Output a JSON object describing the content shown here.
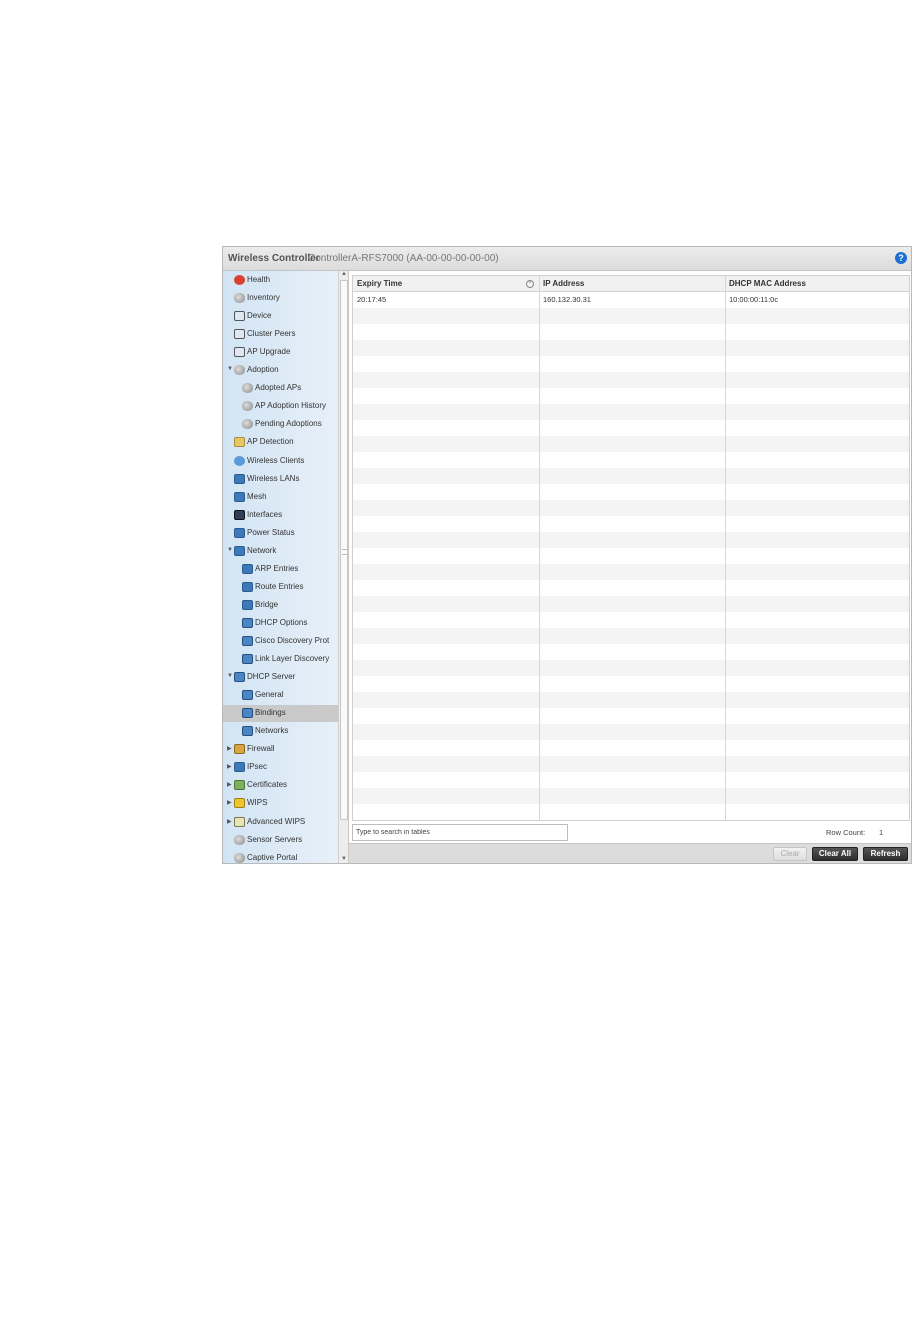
{
  "header": {
    "app_title": "Wireless Controller",
    "controller_id": "ControllerA-RFS7000 (AA-00-00-00-00-00)",
    "help_glyph": "?"
  },
  "sidebar": {
    "items": [
      {
        "label": "Health",
        "icon": "health-icon",
        "level": 0,
        "expander": ""
      },
      {
        "label": "Inventory",
        "icon": "inventory-icon",
        "level": 0,
        "expander": ""
      },
      {
        "label": "Device",
        "icon": "device-icon",
        "level": 0,
        "expander": ""
      },
      {
        "label": "Cluster Peers",
        "icon": "cluster-icon",
        "level": 0,
        "expander": ""
      },
      {
        "label": "AP Upgrade",
        "icon": "ap-upgrade-icon",
        "level": 0,
        "expander": ""
      },
      {
        "label": "Adoption",
        "icon": "adoption-icon",
        "level": 0,
        "expander": "▼"
      },
      {
        "label": "Adopted APs",
        "icon": "ap-icon",
        "level": 1,
        "expander": ""
      },
      {
        "label": "AP Adoption History",
        "icon": "ap-icon",
        "level": 1,
        "expander": ""
      },
      {
        "label": "Pending Adoptions",
        "icon": "ap-icon",
        "level": 1,
        "expander": ""
      },
      {
        "label": "AP Detection",
        "icon": "ap-detection-icon",
        "level": 0,
        "expander": ""
      },
      {
        "label": "Wireless Clients",
        "icon": "clients-icon",
        "level": 0,
        "expander": ""
      },
      {
        "label": "Wireless LANs",
        "icon": "wlan-icon",
        "level": 0,
        "expander": ""
      },
      {
        "label": "Mesh",
        "icon": "mesh-icon",
        "level": 0,
        "expander": ""
      },
      {
        "label": "Interfaces",
        "icon": "interfaces-icon",
        "level": 0,
        "expander": ""
      },
      {
        "label": "Power Status",
        "icon": "power-icon",
        "level": 0,
        "expander": ""
      },
      {
        "label": "Network",
        "icon": "network-icon",
        "level": 0,
        "expander": "▼"
      },
      {
        "label": "ARP Entries",
        "icon": "network-icon",
        "level": 1,
        "expander": ""
      },
      {
        "label": "Route Entries",
        "icon": "network-icon",
        "level": 1,
        "expander": ""
      },
      {
        "label": "Bridge",
        "icon": "bridge-icon",
        "level": 1,
        "expander": ""
      },
      {
        "label": "DHCP Options",
        "icon": "dhcp-icon",
        "level": 1,
        "expander": ""
      },
      {
        "label": "Cisco Discovery Prot",
        "icon": "dhcp-icon",
        "level": 1,
        "expander": ""
      },
      {
        "label": "Link Layer Discovery",
        "icon": "dhcp-icon",
        "level": 1,
        "expander": ""
      },
      {
        "label": "DHCP Server",
        "icon": "dhcp-icon",
        "level": 0,
        "expander": "▼"
      },
      {
        "label": "General",
        "icon": "dhcp-icon",
        "level": 1,
        "expander": ""
      },
      {
        "label": "Bindings",
        "icon": "dhcp-icon",
        "level": 1,
        "expander": "",
        "selected": true
      },
      {
        "label": "Networks",
        "icon": "dhcp-icon",
        "level": 1,
        "expander": ""
      },
      {
        "label": "Firewall",
        "icon": "firewall-icon",
        "level": 0,
        "expander": "▶"
      },
      {
        "label": "IPsec",
        "icon": "ipsec-icon",
        "level": 0,
        "expander": "▶"
      },
      {
        "label": "Certificates",
        "icon": "certificate-icon",
        "level": 0,
        "expander": "▶"
      },
      {
        "label": "WIPS",
        "icon": "wips-icon",
        "level": 0,
        "expander": "▶"
      },
      {
        "label": "Advanced WIPS",
        "icon": "advanced-wips-icon",
        "level": 0,
        "expander": "▶"
      },
      {
        "label": "Sensor Servers",
        "icon": "sensor-icon",
        "level": 0,
        "expander": ""
      },
      {
        "label": "Captive Portal",
        "icon": "captive-portal-icon",
        "level": 0,
        "expander": ""
      }
    ],
    "scroll_up_glyph": "▲",
    "scroll_down_glyph": "▼"
  },
  "table": {
    "columns": [
      "Expiry Time",
      "IP Address",
      "DHCP MAC Address"
    ],
    "sort_glyph": "^",
    "rows": [
      [
        "20:17:45",
        "160.132.30.31",
        "10:00:00:11:0c"
      ]
    ]
  },
  "search": {
    "placeholder": "Type to search in tables"
  },
  "row_count": {
    "label": "Row Count:",
    "value": "1"
  },
  "buttons": {
    "clear": "Clear",
    "clear_all": "Clear All",
    "refresh": "Refresh"
  }
}
